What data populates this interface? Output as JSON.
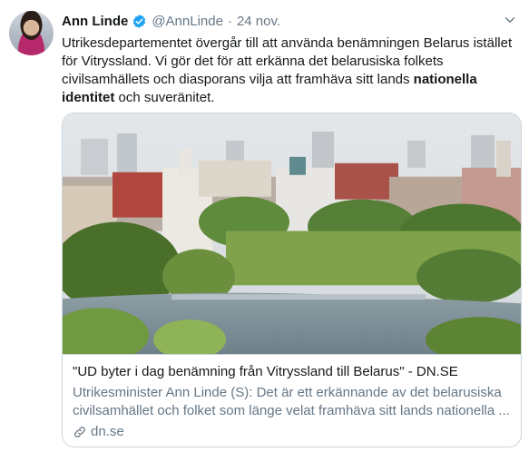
{
  "tweet": {
    "author_name": "Ann Linde",
    "handle": "@AnnLinde",
    "separator": "·",
    "date": "24 nov.",
    "text_line1": "Utrikesdepartementet övergår till att använda benämningen Belarus istället",
    "text_line2": "för Vitryssland. Vi gör det för att erkänna det belarusiska folkets",
    "text_line3_plain": "civilsamhällets och diasporans vilja att framhäva sitt lands ",
    "text_line3_bold": "nationella",
    "text_line4_bold": "identitet",
    "text_line4_plain": " och suveränitet."
  },
  "card": {
    "title": "\"UD byter i dag benämning från Vitryssland till Belarus\" - DN.SE",
    "description": "Utrikesminister Ann Linde (S): Det är ett erkännande av det belarusiska civilsamhället och folket som länge velat framhäva sitt lands nationella ...",
    "domain": "dn.se"
  },
  "colors": {
    "verified": "#1da1f2",
    "secondary_text": "#657786",
    "border": "#ccd6dd"
  }
}
